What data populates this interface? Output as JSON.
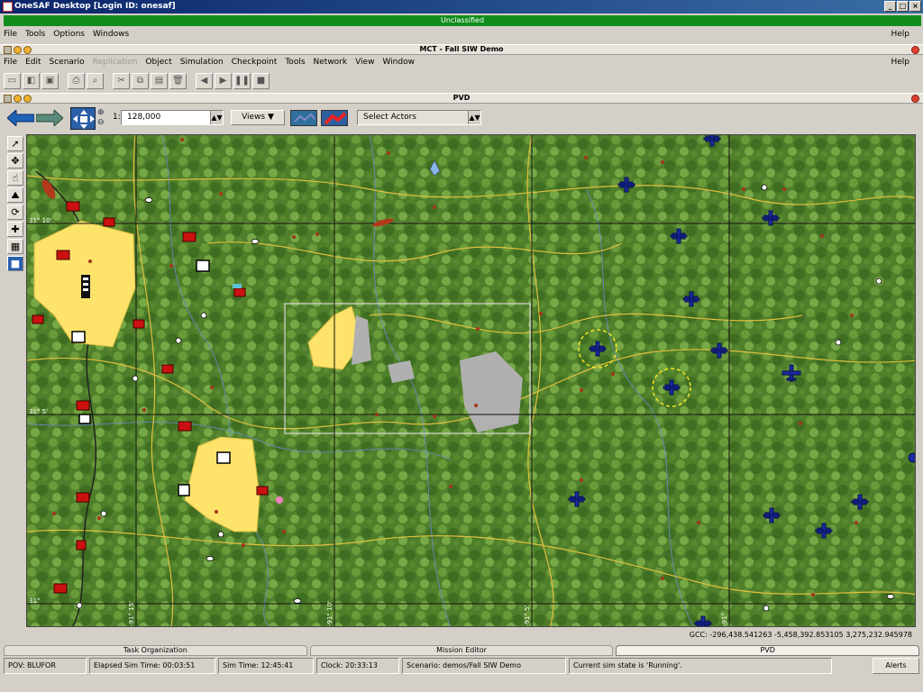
{
  "window": {
    "title": "OneSAF Desktop  [Login ID: onesaf]",
    "controls": [
      "_",
      "□",
      "×"
    ]
  },
  "classification": "Unclassified",
  "desktop_menu": {
    "items": [
      "File",
      "Tools",
      "Options",
      "Windows"
    ],
    "help": "Help"
  },
  "mct_frame": {
    "title": "MCT - Fall SIW Demo"
  },
  "mct_menu": {
    "items": [
      "File",
      "Edit",
      "Scenario",
      "Replication",
      "Object",
      "Simulation",
      "Checkpoint",
      "Tools",
      "Network",
      "View",
      "Window"
    ],
    "help": "Help"
  },
  "pvd_frame": {
    "title": "PVD"
  },
  "pvd_toolbar": {
    "scale_prefix": "1:",
    "scale_value": "128,000",
    "views_label": "Views ▼",
    "actors_label": "Select Actors"
  },
  "map": {
    "grid_labels": {
      "lat1": "31° 10'",
      "lat2": "31° 5'",
      "lat3": "31°",
      "lon1": "-91° 15'",
      "lon2": "-91° 10'",
      "lon3": "-91° 5'",
      "lon4": "-91°"
    },
    "colors": {
      "terrain": "#4f7f2a",
      "urban": "#fde36a",
      "opfor": "#cc1111",
      "blufor": "#1a2aa0",
      "grid": "#111111"
    }
  },
  "coordinates": "GCC: -296,438.541263 -5,458,392.853105 3,275,232.945978",
  "bottom_tabs": [
    {
      "label": "Task Organization",
      "active": false
    },
    {
      "label": "Mission Editor",
      "active": false
    },
    {
      "label": "PVD",
      "active": true
    }
  ],
  "status": {
    "pov": "POV: BLUFOR",
    "elapsed": "Elapsed Sim Time: 00:03:51",
    "simtime": "Sim Time: 12:45:41",
    "clock": "Clock: 20:33:13",
    "scenario": "Scenario: demos/Fall SIW Demo",
    "state": "Current sim state is 'Running'.",
    "alerts": "Alerts"
  }
}
